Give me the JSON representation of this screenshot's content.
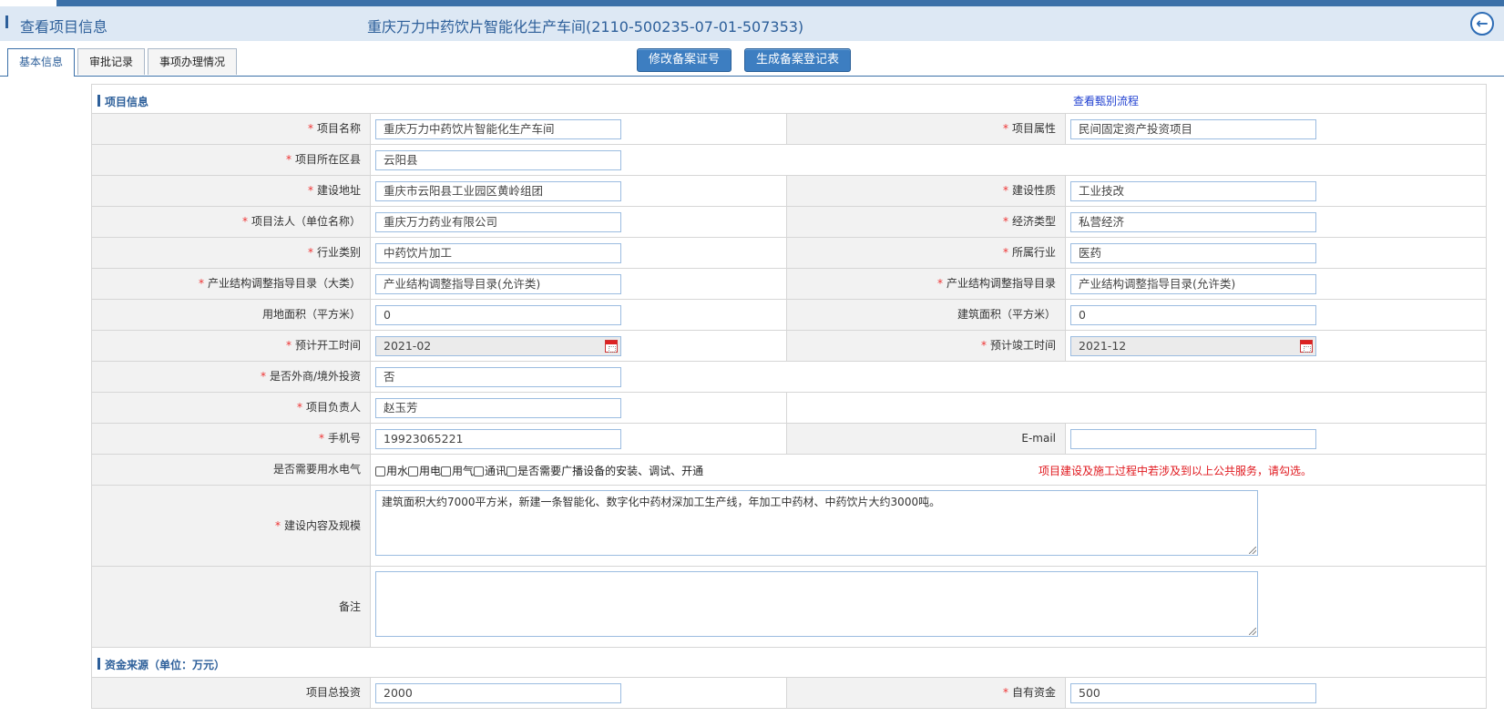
{
  "header": {
    "title": "查看项目信息",
    "project_title": "重庆万力中药饮片智能化生产车间(2110-500235-07-01-507353)",
    "back_icon": "arrow-left-circle-icon"
  },
  "tabs": [
    {
      "label": "基本信息",
      "active": true
    },
    {
      "label": "审批记录",
      "active": false
    },
    {
      "label": "事项办理情况",
      "active": false
    }
  ],
  "buttons": {
    "modify": "修改备案证号",
    "generate": "生成备案登记表"
  },
  "section_project": {
    "title": "项目信息",
    "link": "查看甄别流程"
  },
  "fields": {
    "project_name": {
      "label": "项目名称",
      "value": "重庆万力中药饮片智能化生产车间"
    },
    "project_attr": {
      "label": "项目属性",
      "value": "民间固定资产投资项目"
    },
    "district": {
      "label": "项目所在区县",
      "value": "云阳县"
    },
    "address": {
      "label": "建设地址",
      "value": "重庆市云阳县工业园区黄岭组团"
    },
    "nature": {
      "label": "建设性质",
      "value": "工业技改"
    },
    "legal_person": {
      "label": "项目法人（单位名称）",
      "value": "重庆万力药业有限公司"
    },
    "econ_type": {
      "label": "经济类型",
      "value": "私营经济"
    },
    "industry_cat": {
      "label": "行业类别",
      "value": "中药饮片加工"
    },
    "industry": {
      "label": "所属行业",
      "value": "医药"
    },
    "catalog_major": {
      "label": "产业结构调整指导目录（大类）",
      "value": "产业结构调整指导目录(允许类)"
    },
    "catalog": {
      "label": "产业结构调整指导目录",
      "value": "产业结构调整指导目录(允许类)"
    },
    "land_area": {
      "label": "用地面积（平方米）",
      "value": "0"
    },
    "building_area": {
      "label": "建筑面积（平方米）",
      "value": "0"
    },
    "start_time": {
      "label": "预计开工时间",
      "value": "2021-02"
    },
    "end_time": {
      "label": "预计竣工时间",
      "value": "2021-12"
    },
    "foreign": {
      "label": "是否外商/境外投资",
      "value": "否"
    },
    "manager": {
      "label": "项目负责人",
      "value": "赵玉芳"
    },
    "phone": {
      "label": "手机号",
      "value": "19923065221"
    },
    "email": {
      "label": "E-mail",
      "value": ""
    },
    "utilities": {
      "label": "是否需要用水电气"
    },
    "content": {
      "label": "建设内容及规模",
      "value": "建筑面积大约7000平方米，新建一条智能化、数字化中药材深加工生产线，年加工中药材、中药饮片大约3000吨。"
    },
    "remark": {
      "label": "备注",
      "value": ""
    }
  },
  "utility_options": [
    "用水",
    "用电",
    "用气",
    "通讯",
    "是否需要广播设备的安装、调试、开通"
  ],
  "utility_warning": "项目建设及施工过程中若涉及到以上公共服务，请勾选。",
  "section_funds": {
    "title": "资金来源（单位：万元）"
  },
  "funds": {
    "total": {
      "label": "项目总投资",
      "value": "2000"
    },
    "own": {
      "label": "自有资金",
      "value": "500"
    }
  },
  "required_mark": "*"
}
